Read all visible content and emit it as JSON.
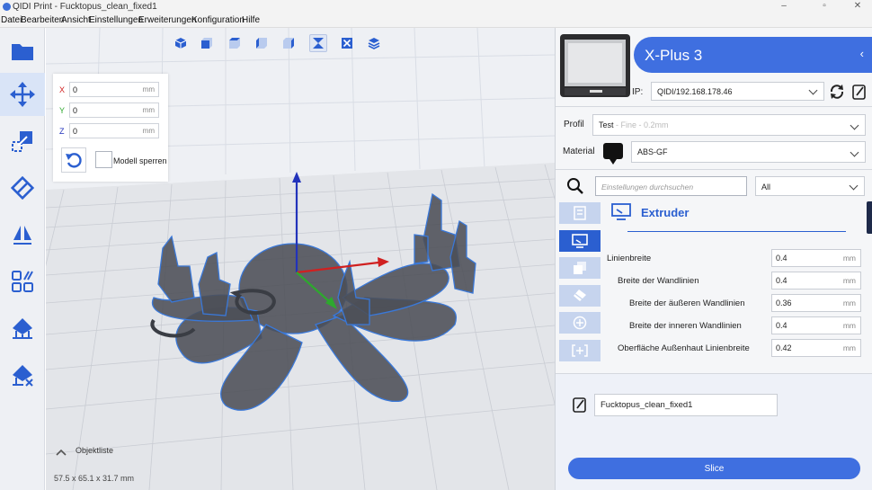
{
  "window": {
    "title": "QIDI Print - Fucktopus_clean_fixed1"
  },
  "menu": [
    "Datei",
    "Bearbeiten",
    "Ansicht",
    "Einstellungen",
    "Erweiterungen",
    "Konfiguration",
    "Hilfe"
  ],
  "left_tools": [
    {
      "name": "open-file-icon",
      "active": false
    },
    {
      "name": "move-icon",
      "active": true
    },
    {
      "name": "scale-icon",
      "active": false
    },
    {
      "name": "rotate-icon",
      "active": false
    },
    {
      "name": "mirror-icon",
      "active": false
    },
    {
      "name": "per-model-settings-icon",
      "active": false
    },
    {
      "name": "support-blocker-icon",
      "active": false
    },
    {
      "name": "support-remove-icon",
      "active": false
    }
  ],
  "view_tools": [
    "3d-view-icon",
    "front-view-icon",
    "top-view-icon",
    "left-view-icon",
    "right-view-icon",
    "x-ray-view-icon",
    "xray-view-icon",
    "layer-view-icon"
  ],
  "move_panel": {
    "x_label": "X",
    "x_value": "0",
    "y_label": "Y",
    "y_value": "0",
    "z_label": "Z",
    "z_value": "0",
    "unit": "mm",
    "lock_label": "Modell sperren",
    "colors": {
      "x": "#d02020",
      "y": "#2ea82e",
      "z": "#2233bb"
    }
  },
  "viewport": {
    "object_list_label": "Objektliste",
    "dimensions": "57.5 x 65.1 x 31.7 mm"
  },
  "printer": {
    "name": "X-Plus 3",
    "ip_label": "IP:",
    "ip_value": "QIDI/192.168.178.46"
  },
  "profile": {
    "label": "Profil",
    "value": "Test",
    "hint": "- Fine - 0.2mm"
  },
  "material": {
    "label": "Material",
    "value": "ABS-GF"
  },
  "settings": {
    "search_placeholder": "Einstellungen durchsuchen",
    "filter_value": "All",
    "section_title": "Extruder",
    "rows": [
      {
        "label": "Linienbreite",
        "value": "0.4",
        "unit": "mm"
      },
      {
        "label": "Breite der Wandlinien",
        "value": "0.4",
        "unit": "mm"
      },
      {
        "label": "Breite der äußeren Wandlinien",
        "value": "0.36",
        "unit": "mm"
      },
      {
        "label": "Breite der inneren Wandlinien",
        "value": "0.4",
        "unit": "mm"
      },
      {
        "label": "Oberfläche Außenhaut Linienbreite",
        "value": "0.42",
        "unit": "mm"
      }
    ]
  },
  "job": {
    "file_name": "Fucktopus_clean_fixed1",
    "slice_label": "Slice"
  },
  "colors": {
    "accent": "#2b5fd0",
    "slice_button": "#3f6fe0",
    "printer_banner": "#3f6fe0"
  }
}
